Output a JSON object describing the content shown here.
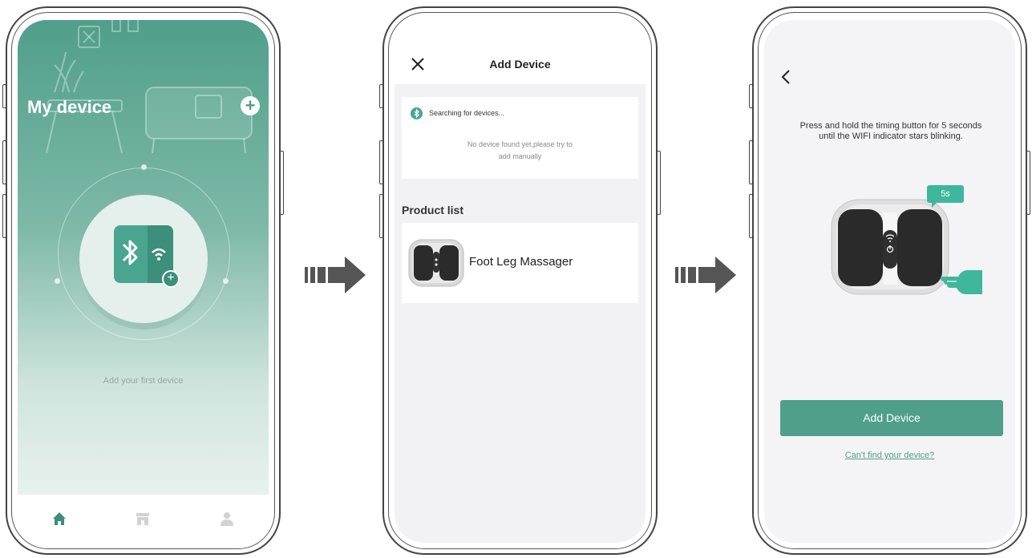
{
  "screen1": {
    "title": "My device",
    "add_button": "+",
    "hint": "Add your first device",
    "tabs": [
      {
        "icon": "home-icon",
        "active": true
      },
      {
        "icon": "store-icon",
        "active": false
      },
      {
        "icon": "user-icon",
        "active": false
      }
    ]
  },
  "screen2": {
    "title": "Add Device",
    "searching": "Searching for devices...",
    "no_device_line1": "No device found yet,please try to",
    "no_device_line2": "add manually",
    "product_list_title": "Product list",
    "product_name": "Foot Leg Massager"
  },
  "screen3": {
    "instruction_line1": "Press and hold the timing button for 5 seconds",
    "instruction_line2": "until the WIFI indicator stars blinking.",
    "timer_badge": "5s",
    "add_button": "Add Device",
    "help_link": "Can't find your device?"
  },
  "colors": {
    "accent": "#4f9f8a",
    "badge": "#3fb79c",
    "arrow": "#555555"
  }
}
